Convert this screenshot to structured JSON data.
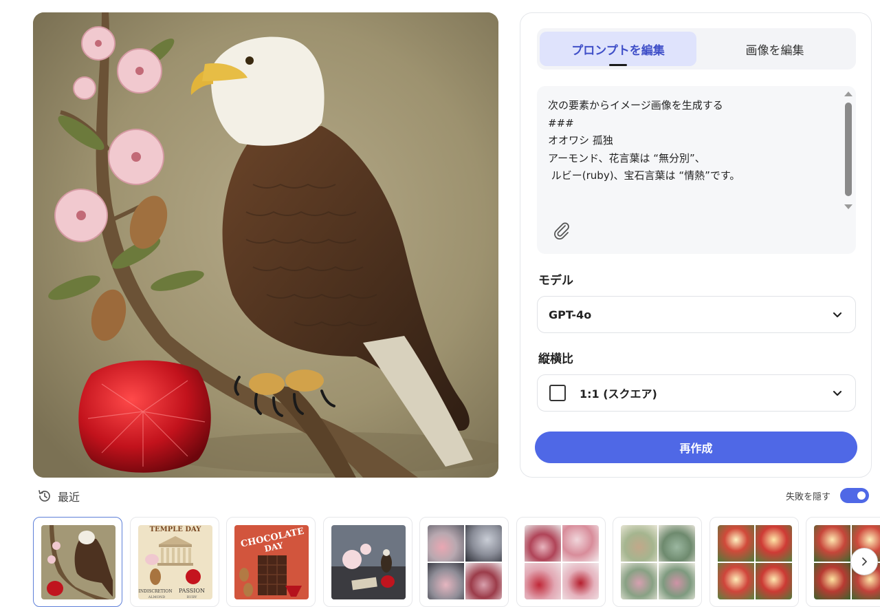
{
  "tabs": {
    "prompt": "プロンプトを編集",
    "image": "画像を編集"
  },
  "prompt": {
    "text": "次の要素からイメージ画像を生成する\n###\nオオワシ 孤独\nアーモンド、花言葉は “無分別”、\n ルビー(ruby)、宝石言葉は “情熱”です。"
  },
  "model": {
    "label": "モデル",
    "value": "GPT-4o"
  },
  "aspect": {
    "label": "縦横比",
    "value": "1:1 (スクエア)"
  },
  "regenerate_label": "再作成",
  "recent": {
    "label": "最近",
    "hide_failed_label": "失敗を隠す",
    "hide_failed_on": true
  },
  "thumbs": {
    "temple_title": "TEMPLE DAY",
    "temple_caption_left": "INDISCRETION",
    "temple_caption_right": "PASSION",
    "temple_sub_left": "ALMOND",
    "temple_sub_right": "RUBY",
    "chocolate_line1": "CHOCOLATE",
    "chocolate_line2": "DAY"
  },
  "icons": {
    "history": "history-icon",
    "attach": "paperclip-icon",
    "chevron": "chevron-down-icon",
    "next": "chevron-right-icon"
  },
  "colors": {
    "accent": "#4f68e6",
    "tab_active_bg": "#dfe3fc",
    "tab_active_text": "#3f4fc8"
  }
}
